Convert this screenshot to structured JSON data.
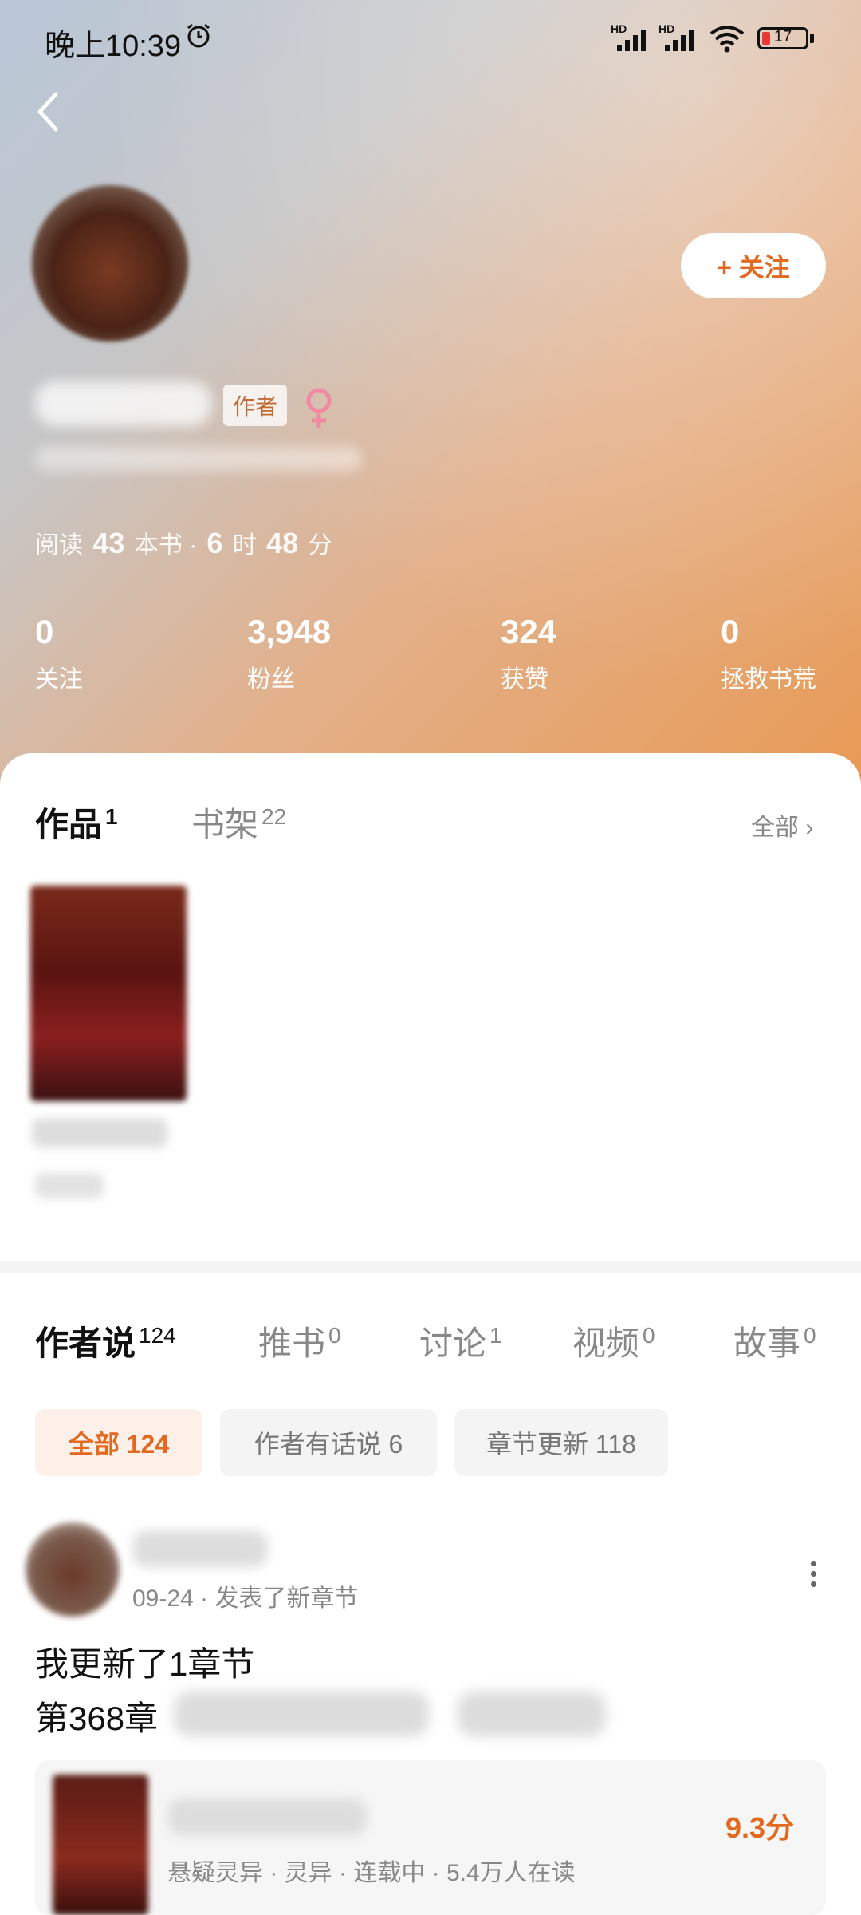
{
  "status_bar": {
    "time": "晚上10:39",
    "battery": "17",
    "hd1": "HD",
    "hd2": "HD"
  },
  "profile": {
    "follow_button": "+ 关注",
    "author_tag": "作者",
    "reading": {
      "prefix": "阅读",
      "books": "43",
      "books_unit": "本书 ·",
      "hours": "6",
      "hours_unit": "时",
      "minutes": "48",
      "minutes_unit": "分"
    },
    "stats": [
      {
        "value": "0",
        "label": "关注"
      },
      {
        "value": "3,948",
        "label": "粉丝"
      },
      {
        "value": "324",
        "label": "获赞"
      },
      {
        "value": "0",
        "label": "拯救书荒"
      }
    ]
  },
  "works_tabs": [
    {
      "label": "作品",
      "count": "1"
    },
    {
      "label": "书架",
      "count": "22"
    }
  ],
  "all_link": "全部 ›",
  "author_tabs": [
    {
      "label": "作者说",
      "count": "124"
    },
    {
      "label": "推书",
      "count": "0"
    },
    {
      "label": "讨论",
      "count": "1"
    },
    {
      "label": "视频",
      "count": "0"
    },
    {
      "label": "故事",
      "count": "0"
    }
  ],
  "filters": [
    {
      "label": "全部 124"
    },
    {
      "label": "作者有话说 6"
    },
    {
      "label": "章节更新 118"
    }
  ],
  "post": {
    "meta": "09-24 · 发表了新章节",
    "line1": "我更新了1章节",
    "line2_prefix": "第368章",
    "book": {
      "tags": "悬疑灵异 · 灵异 · 连载中 · 5.4万人在读",
      "score": "9.3分"
    }
  },
  "colors": {
    "accent": "#e26a20",
    "female": "#f08aa0"
  }
}
